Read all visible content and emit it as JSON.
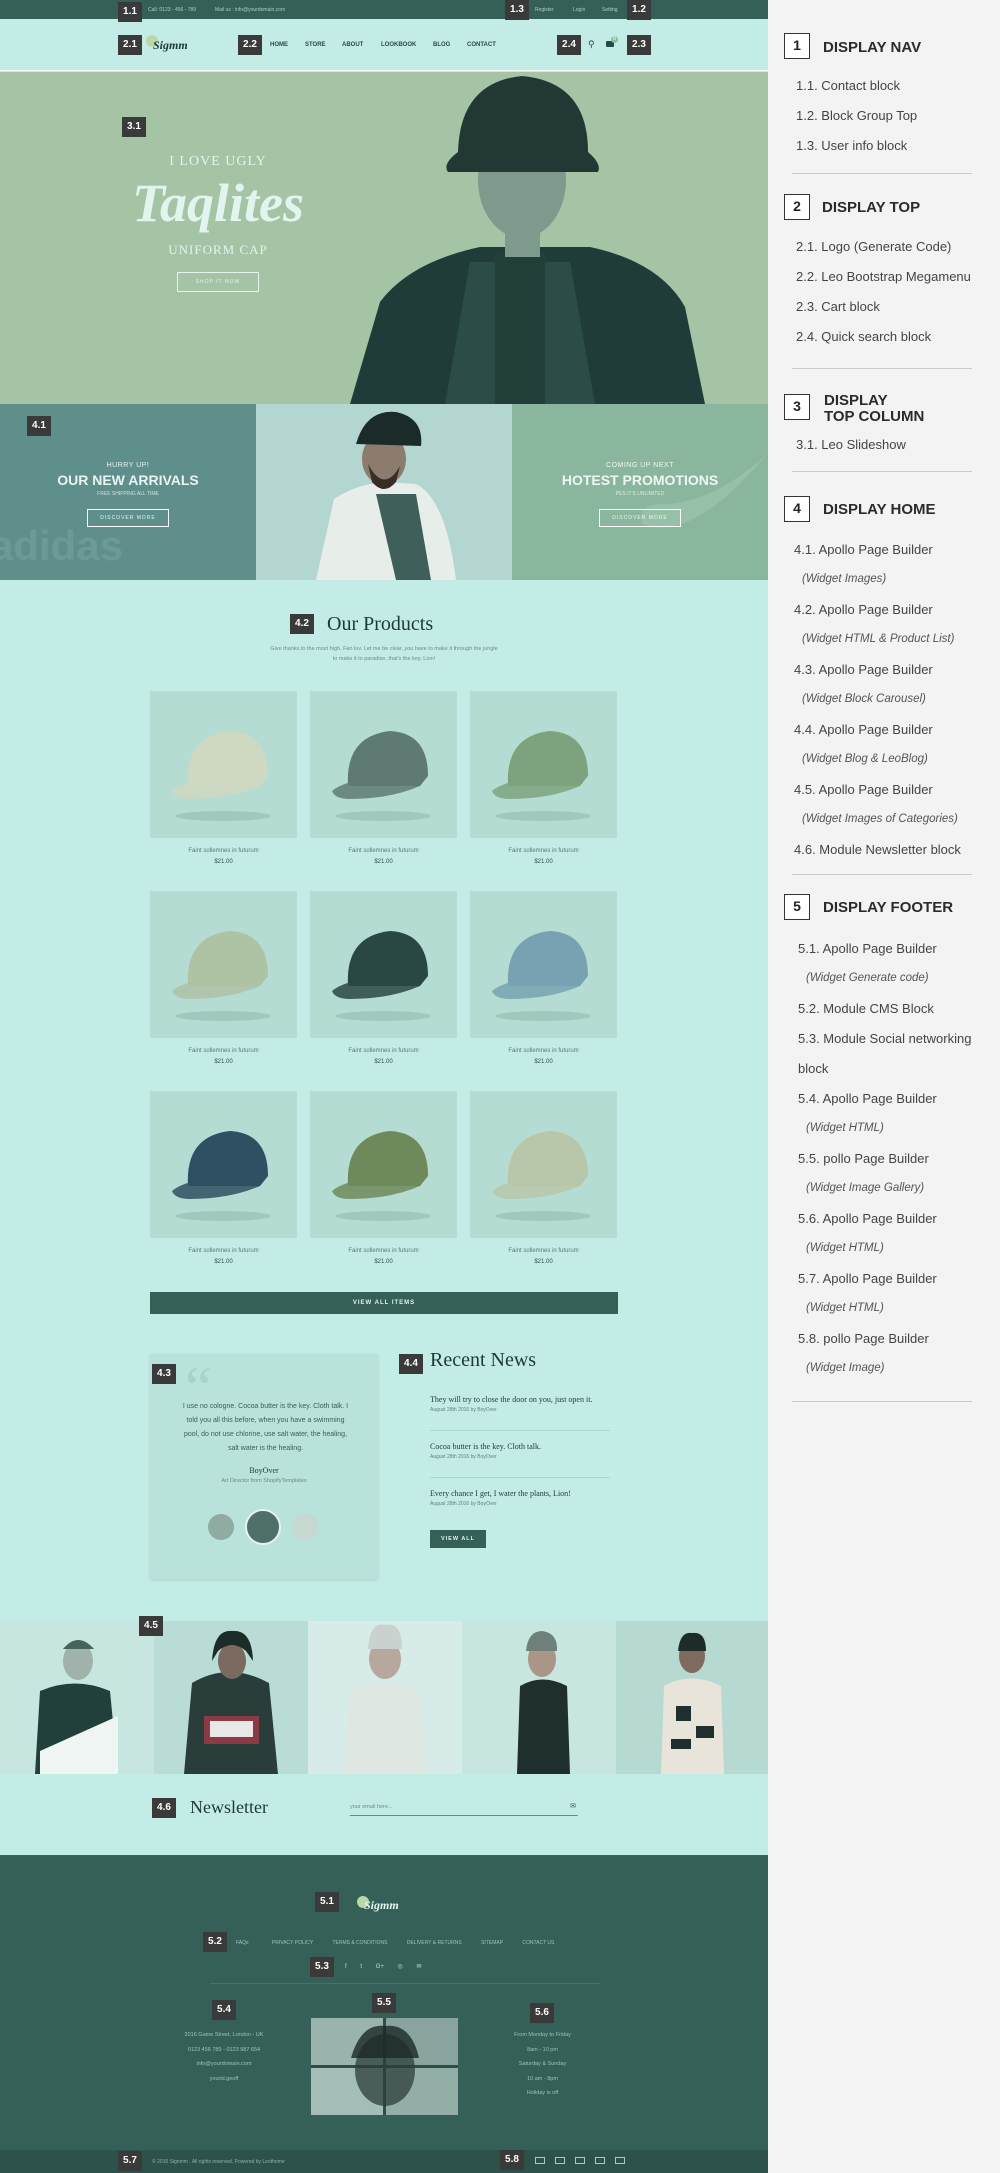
{
  "topnav": {
    "phone": "Call: 0123 - 456 - 789",
    "email": "Mail us : info@yourdomain.com",
    "register": "Register",
    "login": "Login",
    "setting": "Setting"
  },
  "markers": {
    "m1_1": "1.1",
    "m1_2": "1.2",
    "m1_3": "1.3",
    "m2_1": "2.1",
    "m2_2": "2.2",
    "m2_3": "2.3",
    "m2_4": "2.4",
    "m3_1": "3.1",
    "m4_1": "4.1",
    "m4_2": "4.2",
    "m4_3": "4.3",
    "m4_4": "4.4",
    "m4_5": "4.5",
    "m4_6": "4.6",
    "m5_1": "5.1",
    "m5_2": "5.2",
    "m5_3": "5.3",
    "m5_4": "5.4",
    "m5_5": "5.5",
    "m5_6": "5.6",
    "m5_7": "5.7",
    "m5_8": "5.8"
  },
  "header": {
    "logo": "Sigmm",
    "menu": [
      "HOME",
      "STORE",
      "ABOUT",
      "LOOKBOOK",
      "BLOG",
      "CONTACT"
    ],
    "cart_count": "0"
  },
  "hero": {
    "line1": "I LOVE UGLY",
    "script": "Taqlites",
    "line2": "UNIFORM CAP",
    "button": "SHOP IT NOW"
  },
  "banners": [
    {
      "small": "HURRY UP!",
      "big": "OUR NEW ARRIVALS",
      "sub": "FREE SHIPPING ALL TIME",
      "button": "DISCOVER MORE",
      "watermark": "adidas"
    },
    {
      "small": "COMING UP NEXT",
      "big": "HOTEST PROMOTIONS",
      "sub": "PES IT'S UNLIMITED",
      "button": "DISCOVER MORE"
    }
  ],
  "products": {
    "title": "Our Products",
    "intro": "Give thanks to the most high. Fan luv. Let me be clear, you have to make it through the jungle to make it to paradise, that's the key, Lion!",
    "item_name": "Faint sollemnes in futurum",
    "item_price": "$21.00",
    "view_all": "VIEW ALL ITEMS"
  },
  "testimonial": {
    "text": "I use no cologne. Cocoa butter is the key. Cloth talk. I told you all this before, when you have a swimming pool, do not use chlorine, use salt water, the healing, salt water is the healing.",
    "author": "BoyOver",
    "role": "Art Director from ShopifyTemplates"
  },
  "news": {
    "title": "Recent News",
    "items": [
      {
        "title": "They will try to close the door on you, just open it.",
        "meta": "August 28th 2016 by BoyOver"
      },
      {
        "title": "Cocoa butter is the key. Cloth talk.",
        "meta": "August 28th 2016 by BoyOver"
      },
      {
        "title": "Every chance I get, I water the plants, Lion!",
        "meta": "August 28th 2016 by BoyOver"
      }
    ],
    "button": "VIEW ALL"
  },
  "newsletter": {
    "title": "Newsletter",
    "placeholder": "your email here..."
  },
  "footer": {
    "links": [
      "FAQs",
      "PRIVACY POLICY",
      "TERMS & CONDITIONS",
      "DELIVERY & RETURNS",
      "SITEMAP",
      "CONTACT US"
    ],
    "social": [
      "f",
      "t",
      "G+",
      "◎",
      "✉"
    ],
    "address": [
      "2016 Game Street, London - UK",
      "0123 456 789 - 0123 987 654",
      "info@yourdomain.com",
      "yourid.geoff"
    ],
    "hours": [
      "From Monday to Friday",
      "8am - 10 pm",
      "Saturday & Sunday",
      "10 am - 8pm",
      "Holiday is off"
    ],
    "copyright": "© 2016 Signmm . All rights reserved. Powered by Leotheme"
  },
  "panel": {
    "sections": [
      {
        "num": "1",
        "title": "DISPLAY NAV",
        "items": [
          {
            "text": "1.1. Contact block"
          },
          {
            "text": "1.2. Block Group Top"
          },
          {
            "text": "1.3. User info block"
          }
        ]
      },
      {
        "num": "2",
        "title": "DISPLAY TOP",
        "items": [
          {
            "text": "2.1. Logo (Generate Code)"
          },
          {
            "text": "2.2. Leo Bootstrap Megamenu"
          },
          {
            "text": "2.3. Cart block"
          },
          {
            "text": "2.4. Quick search block"
          }
        ]
      },
      {
        "num": "3",
        "title": "DISPLAY",
        "title2": "TOP COLUMN",
        "items": [
          {
            "text": "3.1. Leo Slideshow"
          }
        ]
      },
      {
        "num": "4",
        "title": "DISPLAY HOME",
        "items": [
          {
            "text": "4.1. Apollo Page Builder"
          },
          {
            "text": "(Widget Images)"
          },
          {
            "text": "4.2. Apollo Page Builder"
          },
          {
            "text": "(Widget HTML & Product List)"
          },
          {
            "text": "4.3. Apollo Page Builder"
          },
          {
            "text": "(Widget Block Carousel)"
          },
          {
            "text": "4.4. Apollo Page Builder"
          },
          {
            "text": "(Widget Blog & LeoBlog)"
          },
          {
            "text": "4.5. Apollo Page Builder"
          },
          {
            "text": "(Widget Images of Categories)"
          },
          {
            "text": "4.6. Module Newsletter block"
          }
        ]
      },
      {
        "num": "5",
        "title": "DISPLAY FOOTER",
        "items": [
          {
            "text": "5.1. Apollo Page Builder"
          },
          {
            "text": "(Widget Generate code)"
          },
          {
            "text": "5.2. Module CMS Block"
          },
          {
            "text": "5.3. Module Social networking"
          },
          {
            "text": "block"
          },
          {
            "text": "5.4. Apollo Page Builder"
          },
          {
            "text": "(Widget HTML)"
          },
          {
            "text": "5.5. pollo Page Builder"
          },
          {
            "text": "(Widget Image Gallery)"
          },
          {
            "text": "5.6. Apollo Page Builder"
          },
          {
            "text": "(Widget HTML)"
          },
          {
            "text": "5.7. Apollo Page Builder"
          },
          {
            "text": "(Widget HTML)"
          },
          {
            "text": "5.8. pollo Page Builder"
          },
          {
            "text": "(Widget Image)"
          }
        ]
      }
    ]
  }
}
